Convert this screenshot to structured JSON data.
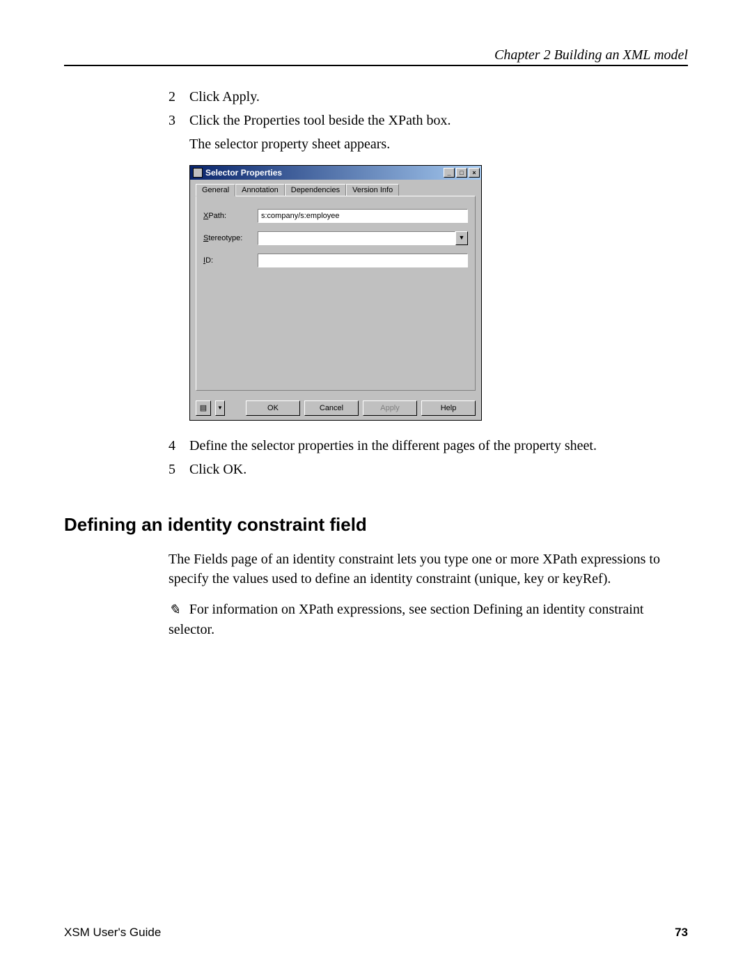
{
  "header": {
    "chapter": "Chapter 2  Building an XML model"
  },
  "steps": {
    "s2": {
      "num": "2",
      "text": "Click Apply."
    },
    "s3": {
      "num": "3",
      "text": "Click the Properties tool beside the XPath box.",
      "sub": "The selector property sheet appears."
    },
    "s4": {
      "num": "4",
      "text": "Define the selector properties in the different pages of the property sheet."
    },
    "s5": {
      "num": "5",
      "text": "Click OK."
    }
  },
  "dialog": {
    "title": "Selector Properties",
    "tabs": {
      "general": "General",
      "annotation": "Annotation",
      "dependencies": "Dependencies",
      "version": "Version Info"
    },
    "labels": {
      "xpath": "XPath:",
      "xpath_u": "X",
      "stereo": "Stereotype:",
      "stereo_u": "S",
      "id": "ID:",
      "id_u": "I"
    },
    "values": {
      "xpath": "s:company/s:employee",
      "stereo": "",
      "id": ""
    },
    "buttons": {
      "ok": "OK",
      "cancel": "Cancel",
      "apply": "Apply",
      "help": "Help"
    },
    "win": {
      "min": "_",
      "max": "□",
      "close": "×"
    }
  },
  "section": {
    "heading": "Defining an identity constraint field"
  },
  "paras": {
    "p1": "The Fields page of an identity constraint lets you type one or more XPath expressions to specify the values used to define an identity constraint (unique, key or keyRef).",
    "p2": "For information on XPath expressions, see section Defining an identity constraint selector."
  },
  "note_glyph": "✎",
  "footer": {
    "guide": "XSM User's Guide",
    "page": "73"
  }
}
